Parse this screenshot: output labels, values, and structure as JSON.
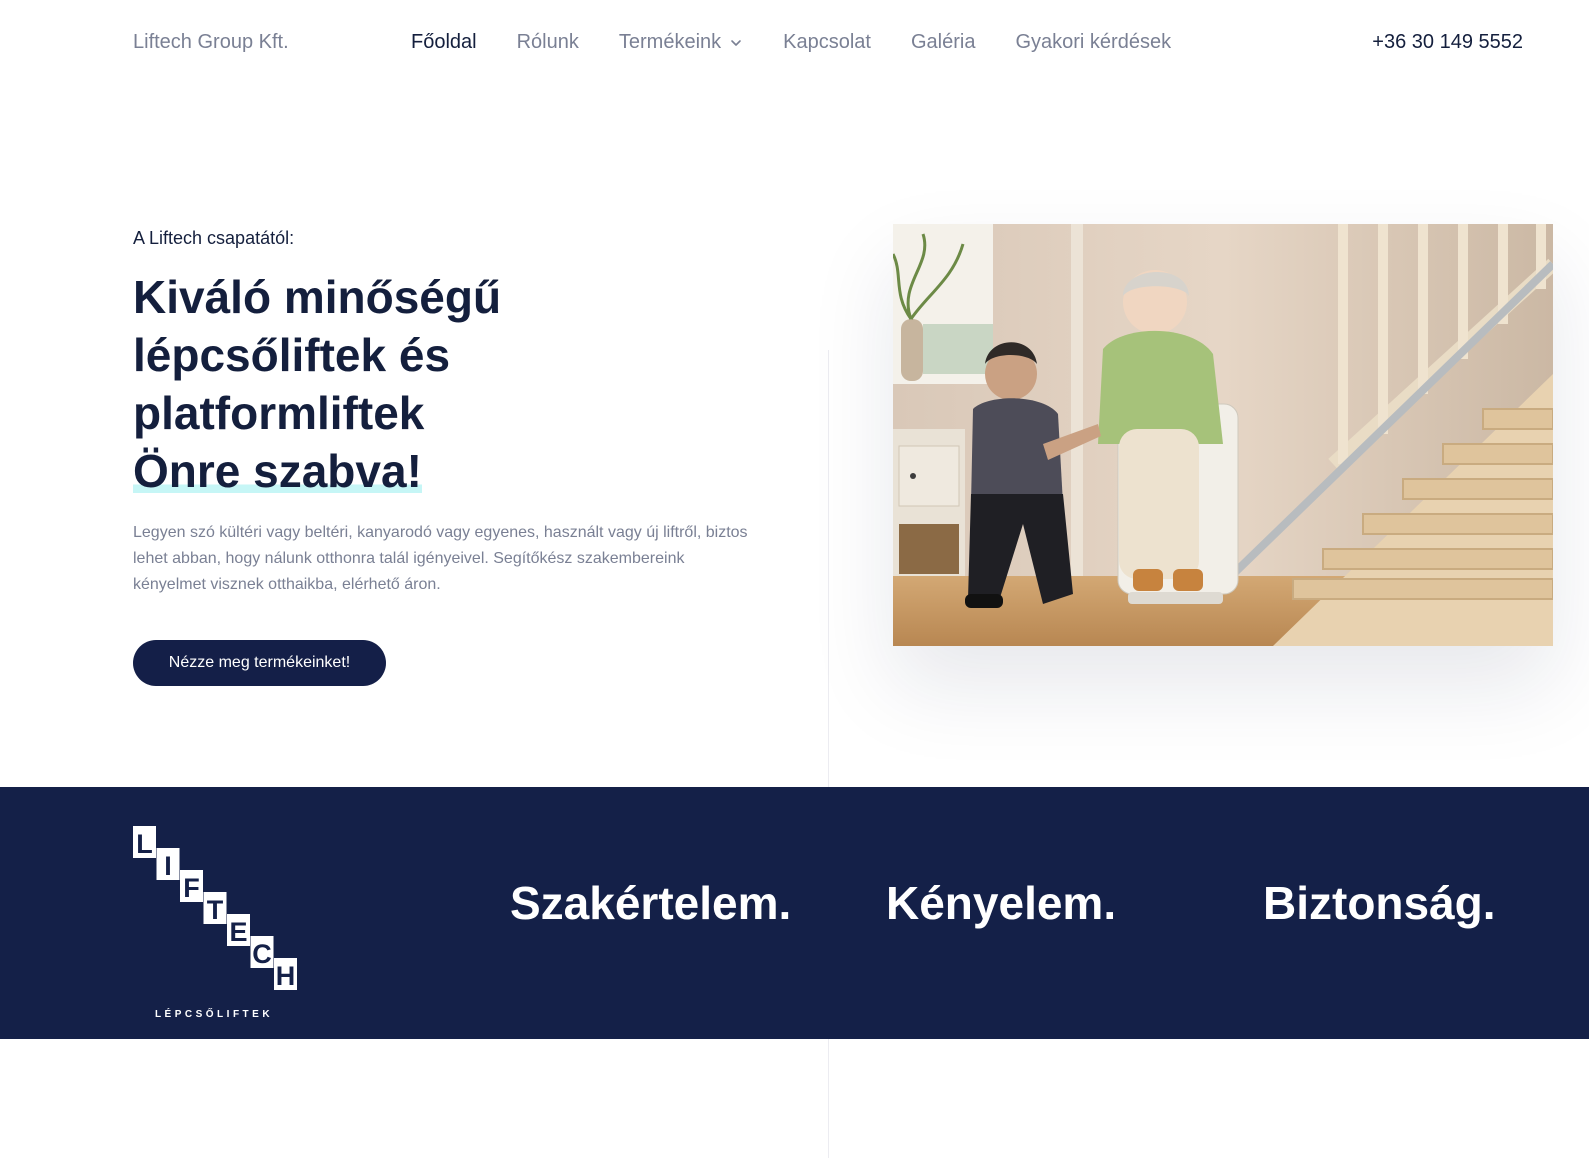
{
  "nav": {
    "brand": "Liftech Group Kft.",
    "links": [
      {
        "label": "Főoldal"
      },
      {
        "label": "Rólunk"
      },
      {
        "label": "Termékeink"
      },
      {
        "label": "Kapcsolat"
      },
      {
        "label": "Galéria"
      },
      {
        "label": "Gyakori kérdések"
      }
    ],
    "phone": "+36 30 149 5552"
  },
  "hero": {
    "eyebrow": "A Liftech csapatától:",
    "headline_lines": [
      "Kiváló minőségű",
      "lépcsőliftek és",
      "platformliftek"
    ],
    "headline_highlight": "Önre szabva!",
    "lead": "Legyen szó kültéri vagy beltéri, kanyarodó vagy egyenes, használt vagy új liftről, biztos lehet abban, hogy nálunk otthonra talál igényeivel. Segítőkész szakembereink kényelmet visznek otthaikba, elérhető áron.",
    "cta_label": "Nézze meg termékeinket!"
  },
  "band": {
    "logo_letters": [
      "L",
      "I",
      "F",
      "T",
      "E",
      "C",
      "H"
    ],
    "logo_tagline": "LÉPCSŐLIFTEK",
    "values": [
      "Szakértelem.",
      "Kényelem.",
      "Biztonság."
    ]
  },
  "colors": {
    "navy": "#142048",
    "text_dark": "#141f3d",
    "text_muted": "#7a8094",
    "highlight": "#c6f6f6"
  }
}
